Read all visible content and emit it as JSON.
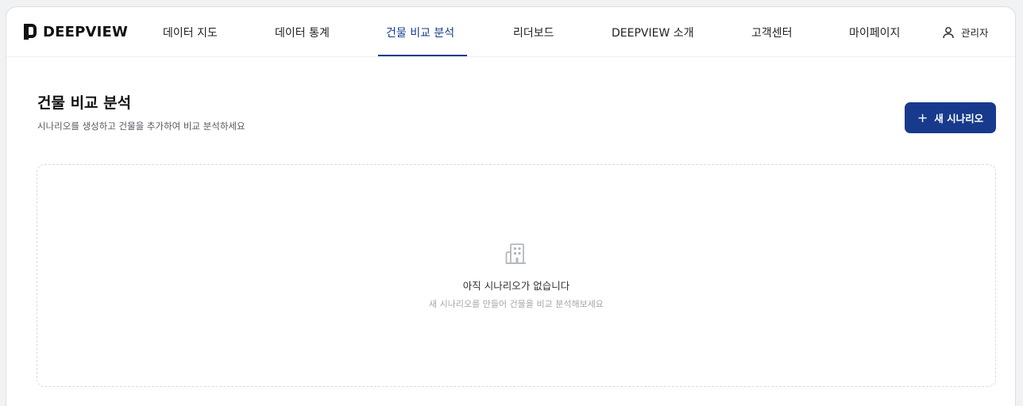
{
  "brand": {
    "name": "DEEPVIEW"
  },
  "nav": {
    "items": [
      {
        "label": "데이터 지도"
      },
      {
        "label": "데이터 통계"
      },
      {
        "label": "건물 비교 분석"
      },
      {
        "label": "리더보드"
      },
      {
        "label": "DEEPVIEW 소개"
      },
      {
        "label": "고객센터"
      },
      {
        "label": "마이페이지"
      }
    ],
    "active_index": 2
  },
  "user": {
    "label": "관리자",
    "icon": "user-icon"
  },
  "page": {
    "title": "건물 비교 분석",
    "subtitle": "시나리오를 생성하고 건물을 추가하여 비교 분석하세요",
    "new_button_label": "새 시나리오",
    "new_button_icon": "plus-icon"
  },
  "empty_state": {
    "icon": "building-icon",
    "title": "아직 시나리오가 없습니다",
    "description": "새 시나리오를 만들어 건물을 비교 분석해보세요"
  },
  "colors": {
    "accent": "#173a8c",
    "muted_text": "#a3a8ae"
  }
}
